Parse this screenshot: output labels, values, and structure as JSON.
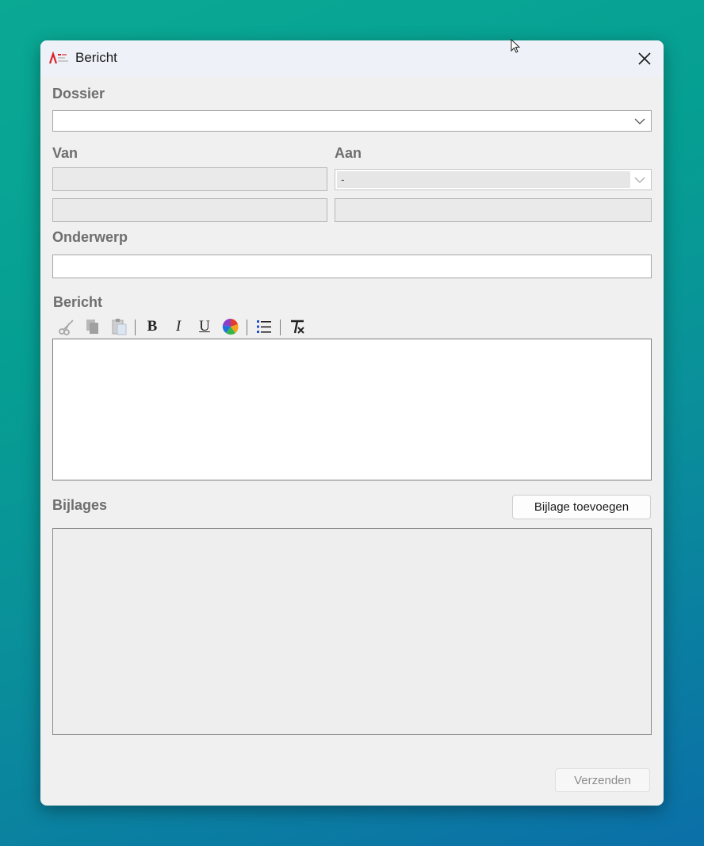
{
  "window": {
    "title": "Bericht"
  },
  "dossier": {
    "label": "Dossier",
    "value": ""
  },
  "van": {
    "label": "Van",
    "line1": "",
    "line2": ""
  },
  "aan": {
    "label": "Aan",
    "selected": "-",
    "line2": ""
  },
  "onderwerp": {
    "label": "Onderwerp",
    "value": ""
  },
  "bericht": {
    "label": "Bericht",
    "toolbar": [
      "scissors-icon",
      "copy-icon",
      "paste-icon",
      "bold",
      "italic",
      "underline",
      "color-wheel-icon",
      "bullet-list-icon",
      "clear-format-icon"
    ],
    "bold_glyph": "B",
    "italic_glyph": "I",
    "underline_glyph": "U",
    "body": ""
  },
  "bijlages": {
    "label": "Bijlages",
    "add_button": "Bijlage toevoegen"
  },
  "footer": {
    "send_button": "Verzenden"
  },
  "colors": {
    "accent_logo": "#d9232e",
    "disabled_text": "#8c8c8c"
  }
}
